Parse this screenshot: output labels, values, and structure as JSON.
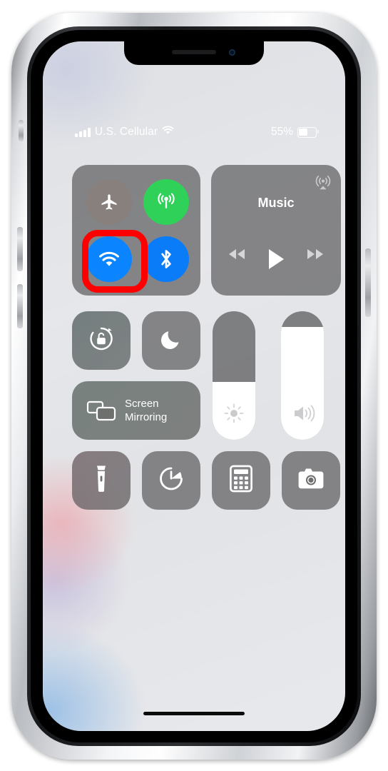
{
  "device": {
    "name": "iphone-x",
    "frame_color": "#d8dade"
  },
  "status_bar": {
    "carrier": "U.S. Cellular",
    "signal_icon": "cellular-signal-icon",
    "signal_bars": 4,
    "wifi_icon": "wifi-icon",
    "battery_percent": "55%",
    "battery_level": 55,
    "battery_icon": "battery-icon"
  },
  "control_center": {
    "connectivity": {
      "name": "connectivity-module",
      "buttons": [
        {
          "name": "airplane-mode",
          "label": "Airplane Mode",
          "icon": "airplane-icon",
          "state": "off",
          "color": "#87807c"
        },
        {
          "name": "cellular-data",
          "label": "Cellular Data",
          "icon": "cellular-antenna-icon",
          "state": "on",
          "color": "#2fd158"
        },
        {
          "name": "wifi",
          "label": "Wi-Fi",
          "icon": "wifi-icon",
          "state": "on",
          "color": "#0a84ff"
        },
        {
          "name": "bluetooth",
          "label": "Bluetooth",
          "icon": "bluetooth-icon",
          "state": "on",
          "color": "#0a7cf7"
        }
      ]
    },
    "music": {
      "name": "music-module",
      "title": "Music",
      "airplay_icon": "airplay-icon",
      "controls": [
        {
          "name": "rewind-button",
          "icon": "rewind-icon"
        },
        {
          "name": "play-button",
          "icon": "play-icon"
        },
        {
          "name": "fast-forward-button",
          "icon": "fast-forward-icon"
        }
      ]
    },
    "tiles": {
      "rotation_lock": {
        "label": "Rotation Lock",
        "icon": "rotation-lock-icon",
        "state": "off"
      },
      "do_not_disturb": {
        "label": "Do Not Disturb",
        "icon": "moon-icon",
        "state": "off"
      },
      "screen_mirroring": {
        "label_line1": "Screen",
        "label_line2": "Mirroring",
        "icon": "screen-mirroring-icon"
      }
    },
    "sliders": {
      "brightness": {
        "name": "brightness-slider",
        "icon": "brightness-icon",
        "value": 45
      },
      "volume": {
        "name": "volume-slider",
        "icon": "volume-icon",
        "value": 88
      }
    },
    "shortcuts": [
      {
        "name": "flashlight-button",
        "label": "Flashlight",
        "icon": "flashlight-icon"
      },
      {
        "name": "timer-button",
        "label": "Timer",
        "icon": "timer-icon"
      },
      {
        "name": "calculator-button",
        "label": "Calculator",
        "icon": "calculator-icon"
      },
      {
        "name": "camera-button",
        "label": "Camera",
        "icon": "camera-icon"
      }
    ]
  },
  "annotation": {
    "name": "wifi-highlight",
    "target": "wifi",
    "color": "#fe0000",
    "shape": "rounded-rectangle"
  },
  "home_indicator": {
    "name": "home-indicator"
  }
}
